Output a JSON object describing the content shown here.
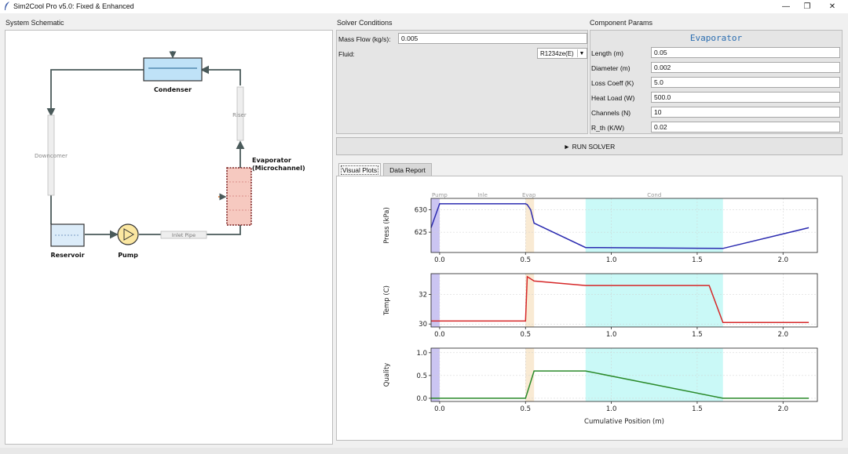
{
  "window": {
    "title": "Sim2Cool Pro v5.0: Fixed & Enhanced",
    "minimize": "—",
    "maximize": "❐",
    "close": "✕"
  },
  "sections": {
    "schematic": "System Schematic",
    "solver": "Solver Conditions",
    "params": "Component Params"
  },
  "schematic": {
    "condenser": "Condenser",
    "riser": "Riser",
    "downcomer": "Downcomer",
    "evaporator_line1": "Evaporator",
    "evaporator_line2": "(Microchannel)",
    "reservoir": "Reservoir",
    "pump": "Pump",
    "inlet_pipe": "Inlet Pipe"
  },
  "solver": {
    "mass_flow_label": "Mass Flow (kg/s):",
    "mass_flow_value": "0.005",
    "fluid_label": "Fluid:",
    "fluid_value": "R1234ze(E)"
  },
  "params": {
    "title": "Evaporator",
    "fields": [
      {
        "label": "Length (m)",
        "value": "0.05"
      },
      {
        "label": "Diameter (m)",
        "value": "0.002"
      },
      {
        "label": "Loss Coeff (K)",
        "value": "5.0"
      },
      {
        "label": "Heat Load (W)",
        "value": "500.0"
      },
      {
        "label": "Channels (N)",
        "value": "10"
      },
      {
        "label": "R_th (K/W)",
        "value": "0.02"
      }
    ]
  },
  "run_button": "► RUN SOLVER",
  "tabs": [
    {
      "label": "Visual Plots",
      "active": true
    },
    {
      "label": "Data Report",
      "active": false
    }
  ],
  "colors": {
    "pressure_line": "#2b2bb0",
    "temp_line": "#d62728",
    "quality_line": "#2a8a2a",
    "pump_region": "#b9b2ee",
    "evap_region": "#f7e3c4",
    "cond_region": "#b8f7f4",
    "evaporator_fill": "#f6c9c0",
    "condenser_fill": "#bfe2f7",
    "reservoir_fill": "#dcecf9",
    "pump_fill": "#fbe7a1"
  },
  "chart_data": {
    "type": "line",
    "xlabel": "Cumulative Position (m)",
    "xlim": [
      -0.05,
      2.2
    ],
    "x_ticks": [
      0.0,
      0.5,
      1.0,
      1.5,
      2.0
    ],
    "x_tick_labels": [
      "0.0",
      "0.5",
      "1.0",
      "1.5",
      "2.0"
    ],
    "regions": [
      {
        "name": "Pump",
        "x0": -0.05,
        "x1": 0.0,
        "color": "#b9b2ee"
      },
      {
        "name": "Evap",
        "x0": 0.5,
        "x1": 0.55,
        "color": "#f7e3c4"
      },
      {
        "name": "Cond",
        "x0": 0.85,
        "x1": 1.65,
        "color": "#b8f7f4"
      }
    ],
    "region_labels": [
      {
        "text": "Pump",
        "x": 0.0
      },
      {
        "text": "Inle",
        "x": 0.25
      },
      {
        "text": "Evap",
        "x": 0.52
      },
      {
        "text": "Cond",
        "x": 1.25
      }
    ],
    "grid": true,
    "subplots": [
      {
        "ylabel": "Press (kPa)",
        "ylim": [
          620.5,
          632.5
        ],
        "y_ticks": [
          625,
          630
        ],
        "series": [
          {
            "x": [
              -0.05,
              0.0,
              0.5,
              0.51,
              0.53,
              0.55,
              0.85,
              1.65,
              2.15
            ],
            "y": [
              626.0,
              631.3,
              631.3,
              631.1,
              630.0,
              627.0,
              621.6,
              621.4,
              626.0
            ]
          }
        ]
      },
      {
        "ylabel": "Temp (C)",
        "ylim": [
          29.8,
          33.4
        ],
        "y_ticks": [
          30,
          32
        ],
        "series": [
          {
            "x": [
              -0.05,
              0.5,
              0.51,
              0.55,
              0.85,
              1.57,
              1.65,
              2.15
            ],
            "y": [
              30.2,
              30.2,
              33.2,
              32.9,
              32.6,
              32.6,
              30.1,
              30.1
            ]
          }
        ]
      },
      {
        "ylabel": "Quality",
        "ylim": [
          -0.07,
          1.1
        ],
        "y_ticks": [
          0.0,
          0.5,
          1.0
        ],
        "series": [
          {
            "x": [
              -0.05,
              0.5,
              0.55,
              0.85,
              1.65,
              2.15
            ],
            "y": [
              0.0,
              0.0,
              0.6,
              0.6,
              0.0,
              0.0
            ]
          }
        ]
      }
    ]
  }
}
